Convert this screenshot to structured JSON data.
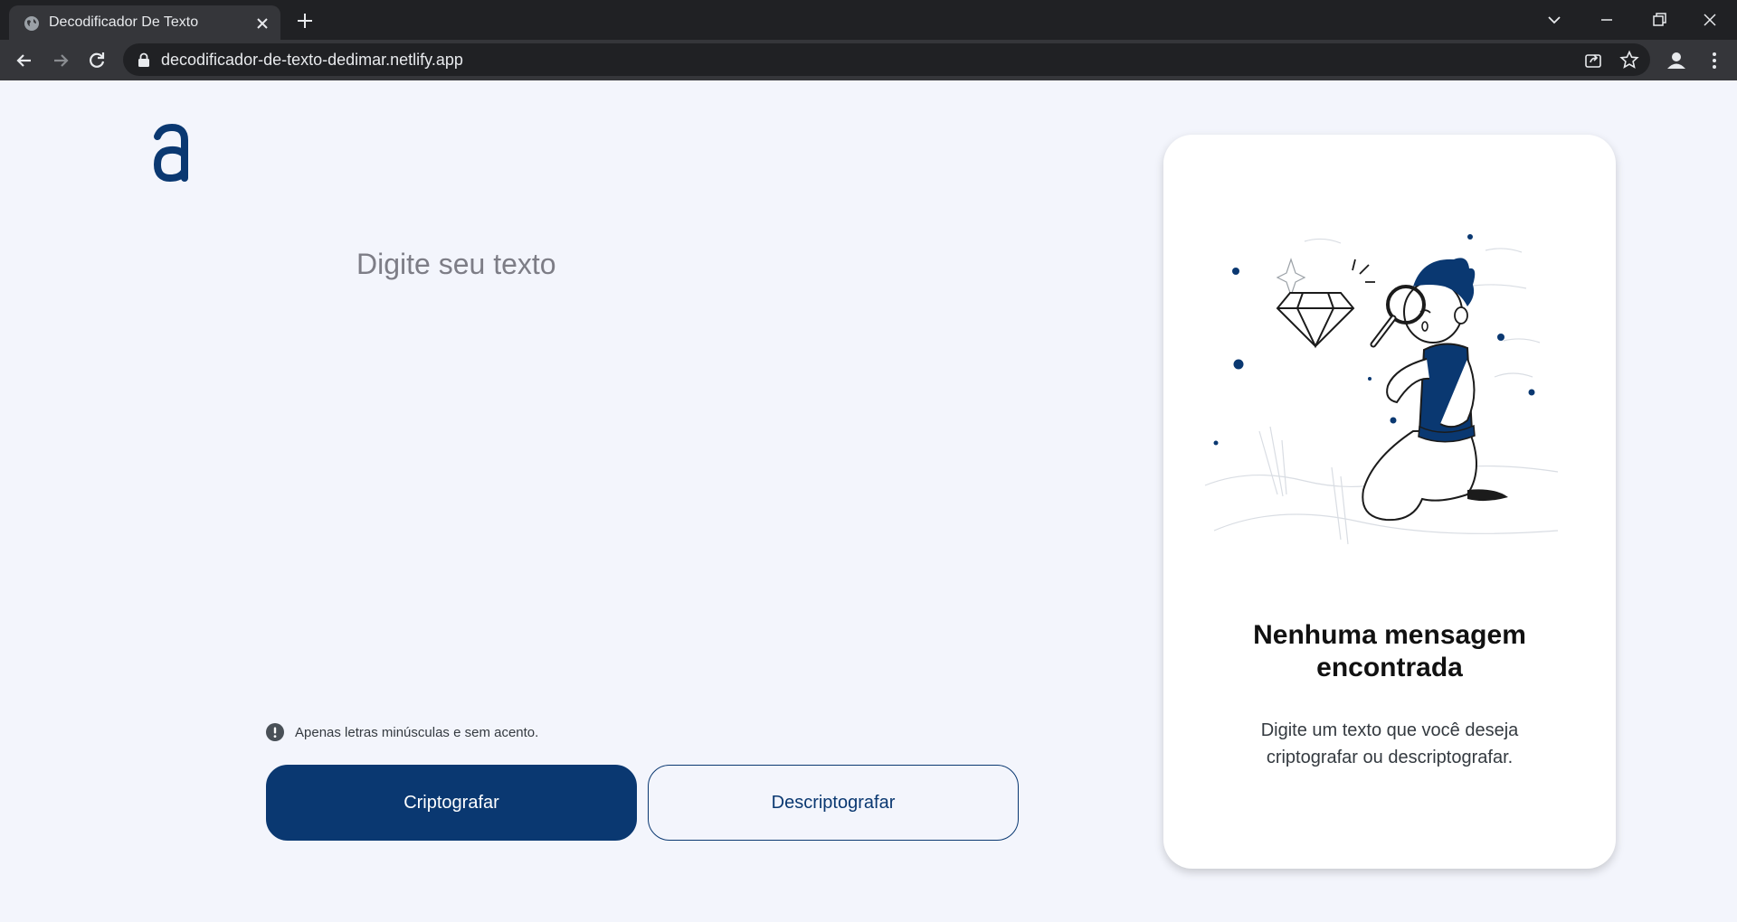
{
  "browser": {
    "tab_title": "Decodificador De Texto",
    "url": "decodificador-de-texto-dedimar.netlify.app"
  },
  "page": {
    "logo_letter": "a",
    "input_placeholder": "Digite seu texto",
    "hint": "Apenas letras minúsculas e sem acento.",
    "encrypt_label": "Criptografar",
    "decrypt_label": "Descriptografar"
  },
  "output": {
    "title": "Nenhuma mensagem encontrada",
    "description": "Digite um texto que você deseja criptografar ou descriptografar."
  },
  "colors": {
    "primary": "#0a3871",
    "background": "#f3f5fc",
    "card": "#ffffff"
  }
}
